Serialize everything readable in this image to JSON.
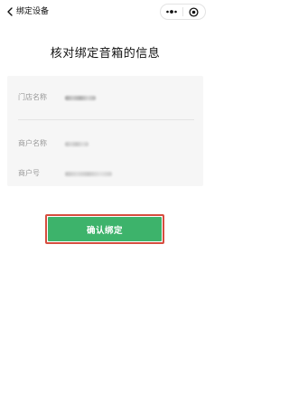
{
  "nav": {
    "title": "绑定设备",
    "icons": [
      "chevron-left-icon",
      "more-dots-icon",
      "close-circle-icon"
    ]
  },
  "page": {
    "title": "核对绑定音箱的信息"
  },
  "info": {
    "rows": [
      {
        "label": "门店名称"
      },
      {
        "label": "商户名称"
      },
      {
        "label": "商户号"
      }
    ]
  },
  "action": {
    "confirm_label": "确认绑定"
  },
  "colors": {
    "primary": "#3db36b",
    "highlight_border": "#d64d3f",
    "card_bg": "#f6f6f6",
    "label": "#9a9a9a"
  }
}
